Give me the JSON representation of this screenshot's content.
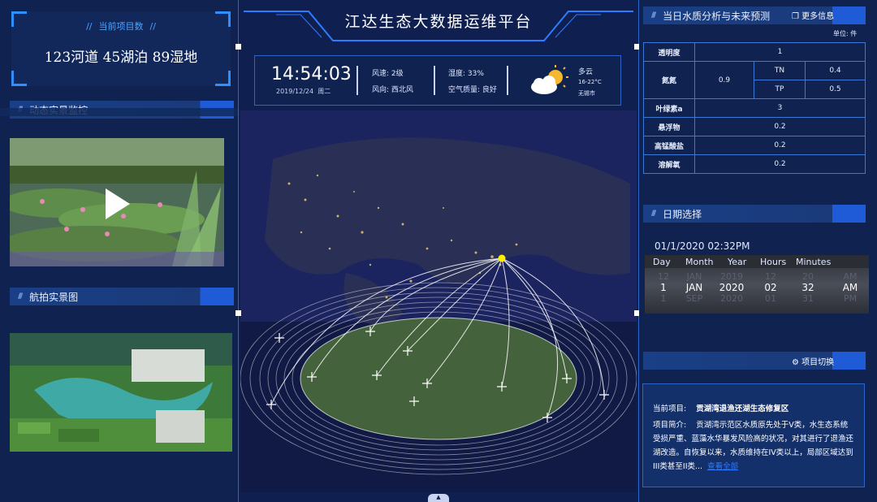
{
  "left": {
    "project_count": {
      "title": "当前项目数",
      "value": "123河道 45湖泊 89湿地"
    },
    "video_panel": {
      "title": "动态实景监控"
    },
    "aerial_panel": {
      "title": "航拍实景图"
    }
  },
  "header": {
    "title": "江达生态大数据运维平台",
    "time": "14:54:03",
    "date": "2019/12/24",
    "weekday": "周二",
    "wind_speed": "风速: 2级",
    "wind_dir": "风向: 西北风",
    "humidity": "湿度: 33%",
    "air_quality": "空气质量: 良好",
    "weather": "多云",
    "temp": "16-22°C",
    "city": "无锡市"
  },
  "water": {
    "title": "当日水质分析与未来预测",
    "more": "更多信息",
    "unit": "单位: 件",
    "rows": {
      "transparency": {
        "label": "透明度",
        "value": "1"
      },
      "nitrogen": {
        "label": "氮氮",
        "value": "0.9",
        "tn_label": "TN",
        "tn_value": "0.4",
        "tp_label": "TP",
        "tp_value": "0.5"
      },
      "chlorophyll": {
        "label": "叶绿素a",
        "value": "3"
      },
      "suspended": {
        "label": "悬浮物",
        "value": "0.2"
      },
      "permanganate": {
        "label": "高锰酸盐",
        "value": "0.2"
      },
      "oxygen": {
        "label": "溶解氧",
        "value": "0.2"
      }
    }
  },
  "date_select": {
    "title": "日期选择",
    "current": "01/1/2020 02:32PM",
    "headers": [
      "Day",
      "Month",
      "Year",
      "Hours",
      "Minutes"
    ],
    "columns": {
      "day": [
        "12",
        "1",
        "1"
      ],
      "month": [
        "JAN",
        "JAN",
        "SEP"
      ],
      "year": [
        "2019",
        "2020",
        "2020"
      ],
      "hours": [
        "12",
        "02",
        "01"
      ],
      "minutes": [
        "20",
        "32",
        "31"
      ],
      "ampm": [
        "AM",
        "AM",
        "PM"
      ]
    }
  },
  "project": {
    "title": "项目切换",
    "current_label": "当前项目:",
    "current_value": "贡湖湾退渔还湖生态修复区",
    "intro_label": "项目简介:",
    "intro_text": "贡湖湾示范区水质原先处于V类，水生态系统受损严重、蓝藻水华暴发风险高的状况，对其进行了退渔还湖改造。自恢复以来，水质维持在IV类以上，局部区域达到III类甚至II类...",
    "more_link": "查看全部"
  },
  "colors": {
    "accent": "#1f5bd6",
    "link": "#2f7bff",
    "sun": "#f5b82e"
  }
}
